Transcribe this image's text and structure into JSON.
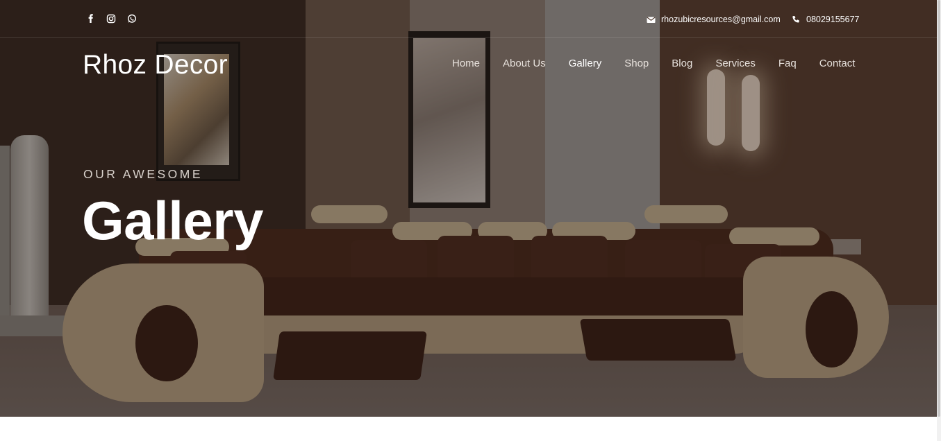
{
  "topbar": {
    "social": [
      {
        "icon": "facebook-icon"
      },
      {
        "icon": "instagram-icon"
      },
      {
        "icon": "whatsapp-icon"
      }
    ],
    "email": {
      "icon": "envelope-icon",
      "text": "rhozubicresources@gmail.com"
    },
    "phone": {
      "icon": "phone-icon",
      "text": "08029155677"
    }
  },
  "header": {
    "logo": "Rhoz Decor",
    "nav": [
      {
        "label": "Home"
      },
      {
        "label": "About Us"
      },
      {
        "label": "Gallery",
        "active": true
      },
      {
        "label": "Shop"
      },
      {
        "label": "Blog"
      },
      {
        "label": "Services"
      },
      {
        "label": "Faq"
      },
      {
        "label": "Contact"
      }
    ]
  },
  "hero": {
    "kicker": "OUR AWESOME",
    "title": "Gallery",
    "background_image": "living room with brown and cream sectional sofa"
  },
  "colors": {
    "text": "#ffffff",
    "nav_text": "#e7e1dc",
    "overlay": "#140c08"
  }
}
